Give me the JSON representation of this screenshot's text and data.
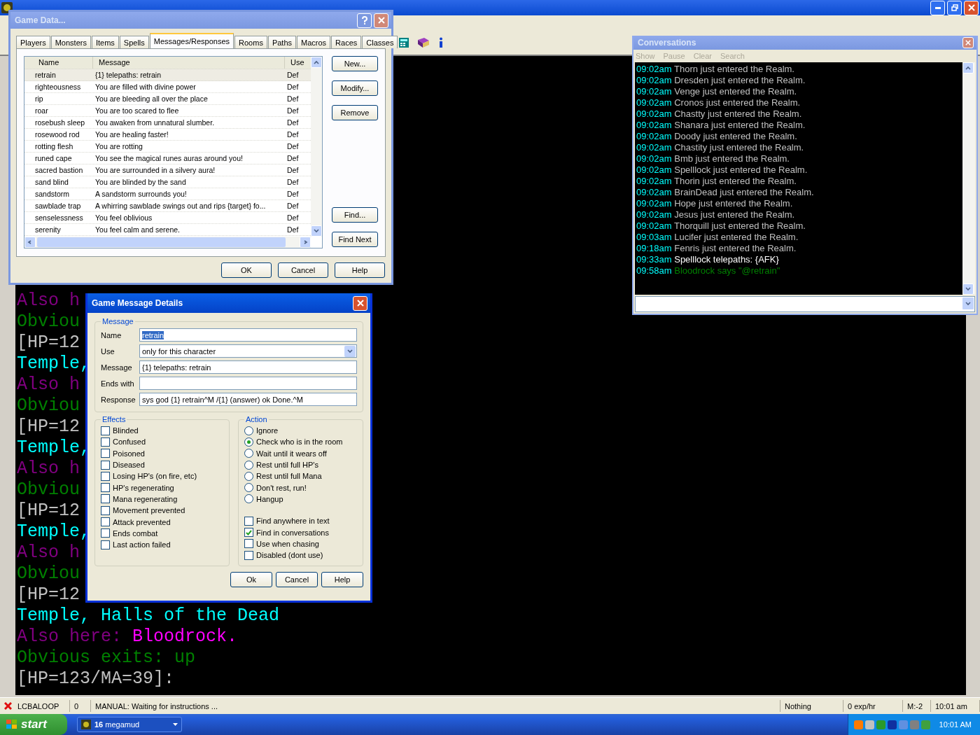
{
  "terminal": {
    "lines": [
      {
        "segments": [
          {
            "text": "Also h",
            "color": "#800080"
          }
        ]
      },
      {
        "segments": [
          {
            "text": "Obviou",
            "color": "#008000"
          }
        ]
      },
      {
        "segments": [
          {
            "text": "[HP=12",
            "color": "#c0c0c0"
          }
        ]
      },
      {
        "segments": [
          {
            "text": "Temple,",
            "color": "#00ffff"
          }
        ]
      },
      {
        "segments": [
          {
            "text": "Also h",
            "color": "#800080"
          }
        ]
      },
      {
        "segments": [
          {
            "text": "Obviou",
            "color": "#008000"
          }
        ]
      },
      {
        "segments": [
          {
            "text": "[HP=12",
            "color": "#c0c0c0"
          }
        ]
      },
      {
        "segments": [
          {
            "text": "Temple,",
            "color": "#00ffff"
          }
        ]
      },
      {
        "segments": [
          {
            "text": "Also h",
            "color": "#800080"
          }
        ]
      },
      {
        "segments": [
          {
            "text": "Obviou",
            "color": "#008000"
          }
        ]
      },
      {
        "segments": [
          {
            "text": "[HP=12",
            "color": "#c0c0c0"
          }
        ]
      },
      {
        "segments": [
          {
            "text": "Temple,",
            "color": "#00ffff"
          }
        ]
      },
      {
        "segments": [
          {
            "text": "Also h",
            "color": "#800080"
          }
        ]
      },
      {
        "segments": [
          {
            "text": "Obviou",
            "color": "#008000"
          }
        ]
      },
      {
        "segments": [
          {
            "text": "[HP=12",
            "color": "#c0c0c0"
          }
        ]
      },
      {
        "segments": [
          {
            "text": "Temple, Halls of the Dead",
            "color": "#00ffff"
          }
        ]
      },
      {
        "segments": [
          {
            "text": "Also here: ",
            "color": "#800080"
          },
          {
            "text": "Bloodrock.",
            "color": "#ff00ff"
          }
        ]
      },
      {
        "segments": [
          {
            "text": "Obvious exits: up",
            "color": "#008000"
          }
        ]
      },
      {
        "segments": [
          {
            "text": "[HP=123/MA=39]:",
            "color": "#c0c0c0"
          }
        ]
      }
    ]
  },
  "game_data": {
    "title": "Game Data...",
    "tabs": [
      {
        "label": "Players",
        "selected": false
      },
      {
        "label": "Monsters",
        "selected": false
      },
      {
        "label": "Items",
        "selected": false
      },
      {
        "label": "Spells",
        "selected": false
      },
      {
        "label": "Messages/Responses",
        "selected": true
      },
      {
        "label": "Rooms",
        "selected": false
      },
      {
        "label": "Paths",
        "selected": false
      },
      {
        "label": "Macros",
        "selected": false
      },
      {
        "label": "Races",
        "selected": false
      },
      {
        "label": "Classes",
        "selected": false
      }
    ],
    "table": {
      "columns": [
        "Name",
        "Message",
        "Use"
      ],
      "rows": [
        {
          "name": "retrain",
          "message": "{1} telepaths: retrain",
          "use": "Def",
          "selected": true
        },
        {
          "name": "righteousness",
          "message": "You are filled with divine power",
          "use": "Def",
          "selected": false
        },
        {
          "name": "rip",
          "message": "You are bleeding all over the place",
          "use": "Def",
          "selected": false
        },
        {
          "name": "roar",
          "message": "You are too scared to flee",
          "use": "Def",
          "selected": false
        },
        {
          "name": "rosebush sleep",
          "message": "You awaken from unnatural slumber.",
          "use": "Def",
          "selected": false
        },
        {
          "name": "rosewood rod",
          "message": "You are healing faster!",
          "use": "Def",
          "selected": false
        },
        {
          "name": "rotting flesh",
          "message": "You are rotting",
          "use": "Def",
          "selected": false
        },
        {
          "name": "runed cape",
          "message": "You see the magical runes auras around you!",
          "use": "Def",
          "selected": false
        },
        {
          "name": "sacred bastion",
          "message": "You are surrounded in a silvery aura!",
          "use": "Def",
          "selected": false
        },
        {
          "name": "sand blind",
          "message": "You are blinded by the sand",
          "use": "Def",
          "selected": false
        },
        {
          "name": "sandstorm",
          "message": "A sandstorm surrounds you!",
          "use": "Def",
          "selected": false
        },
        {
          "name": "sawblade trap",
          "message": "A whirring sawblade swings out and rips {target} fo...",
          "use": "Def",
          "selected": false
        },
        {
          "name": "senselessness",
          "message": "You feel oblivious",
          "use": "Def",
          "selected": false
        },
        {
          "name": "serenity",
          "message": "You feel calm and serene.",
          "use": "Def",
          "selected": false
        }
      ]
    },
    "side_buttons": [
      "New...",
      "Modify...",
      "Remove",
      "Find...",
      "Find Next"
    ],
    "bottom_buttons": [
      "OK",
      "Cancel",
      "Help"
    ]
  },
  "details": {
    "title": "Game Message Details",
    "message_group": {
      "legend": "Message",
      "fields": [
        {
          "kind": "text",
          "label": "Name",
          "value": "retrain",
          "highlighted": true
        },
        {
          "kind": "select",
          "label": "Use",
          "value": "only for this character"
        },
        {
          "kind": "text",
          "label": "Message",
          "value": "{1} telepaths: retrain"
        },
        {
          "kind": "text",
          "label": "Ends with"
        },
        {
          "kind": "text",
          "label": "Response",
          "value": "sys god {1} retrain^M /{1} (answer) ok Done.^M"
        }
      ]
    },
    "effects": {
      "legend": "Effects",
      "items": [
        {
          "label": "Blinded",
          "checked": false
        },
        {
          "label": "Confused",
          "checked": false
        },
        {
          "label": "Poisoned",
          "checked": false
        },
        {
          "label": "Diseased",
          "checked": false
        },
        {
          "label": "Losing HP's (on fire, etc)",
          "checked": false
        },
        {
          "label": "HP's regenerating",
          "checked": false
        },
        {
          "label": "Mana regenerating",
          "checked": false
        },
        {
          "label": "Movement prevented",
          "checked": false
        },
        {
          "label": "Attack prevented",
          "checked": false
        },
        {
          "label": "Ends combat",
          "checked": false
        },
        {
          "label": "Last action failed",
          "checked": false
        }
      ]
    },
    "action": {
      "legend": "Action",
      "options": [
        {
          "label": "Ignore",
          "selected": false
        },
        {
          "label": "Check who is in the room",
          "selected": true
        },
        {
          "label": "Wait until it wears off",
          "selected": false
        },
        {
          "label": "Rest until full HP's",
          "selected": false
        },
        {
          "label": "Rest until full Mana",
          "selected": false
        },
        {
          "label": "Don't rest, run!",
          "selected": false
        },
        {
          "label": "Hangup",
          "selected": false
        }
      ],
      "flags": [
        {
          "label": "Find anywhere in text",
          "checked": false
        },
        {
          "label": "Find in conversations",
          "checked": true
        },
        {
          "label": "Use when chasing",
          "checked": false
        },
        {
          "label": "Disabled (dont use)",
          "checked": false
        }
      ]
    },
    "buttons": [
      "Ok",
      "Cancel",
      "Help"
    ]
  },
  "conversations": {
    "title": "Conversations",
    "menu": [
      {
        "label": "Show",
        "disabled": true
      },
      {
        "label": "Pause",
        "disabled": true
      },
      {
        "label": "Clear",
        "disabled": true
      },
      {
        "label": "Search",
        "disabled": true
      }
    ],
    "log": [
      {
        "time": "09:02am",
        "text": "Thorn just entered the Realm.",
        "color": "#c0c0c0"
      },
      {
        "time": "09:02am",
        "text": "Dresden just entered the Realm.",
        "color": "#c0c0c0"
      },
      {
        "time": "09:02am",
        "text": "Venge just entered the Realm.",
        "color": "#c0c0c0"
      },
      {
        "time": "09:02am",
        "text": "Cronos just entered the Realm.",
        "color": "#c0c0c0"
      },
      {
        "time": "09:02am",
        "text": "Chastty just entered the Realm.",
        "color": "#c0c0c0"
      },
      {
        "time": "09:02am",
        "text": "Shanara just entered the Realm.",
        "color": "#c0c0c0"
      },
      {
        "time": "09:02am",
        "text": "Doody just entered the Realm.",
        "color": "#c0c0c0"
      },
      {
        "time": "09:02am",
        "text": "Chastity just entered the Realm.",
        "color": "#c0c0c0"
      },
      {
        "time": "09:02am",
        "text": "Bmb just entered the Realm.",
        "color": "#c0c0c0"
      },
      {
        "time": "09:02am",
        "text": "Spelllock just entered the Realm.",
        "color": "#c0c0c0"
      },
      {
        "time": "09:02am",
        "text": "Thorin just entered the Realm.",
        "color": "#c0c0c0"
      },
      {
        "time": "09:02am",
        "text": "BrainDead just entered the Realm.",
        "color": "#c0c0c0"
      },
      {
        "time": "09:02am",
        "text": "Hope just entered the Realm.",
        "color": "#c0c0c0"
      },
      {
        "time": "09:02am",
        "text": "Jesus just entered the Realm.",
        "color": "#c0c0c0"
      },
      {
        "time": "09:02am",
        "text": "Thorquill just entered the Realm.",
        "color": "#c0c0c0"
      },
      {
        "time": "09:03am",
        "text": "Lucifer just entered the Realm.",
        "color": "#c0c0c0"
      },
      {
        "time": "09:18am",
        "text": "Fenris just entered the Realm.",
        "color": "#c0c0c0"
      },
      {
        "time": "09:33am",
        "text": "Spelllock telepaths: {AFK}",
        "color": "#ffffff"
      },
      {
        "time": "09:58am",
        "text": "Bloodrock says \"@retrain\"",
        "color": "#008000"
      }
    ]
  },
  "status_bar": {
    "fields": [
      "LCBALOOP",
      "0",
      "MANUAL: Waiting for instructions ...",
      "Nothing",
      "0 exp/hr",
      "M:-2",
      "10:01 am"
    ]
  },
  "taskbar": {
    "start": "start",
    "tasks": [
      {
        "label": "**16** megamud"
      }
    ],
    "clock": "10:01 AM"
  }
}
